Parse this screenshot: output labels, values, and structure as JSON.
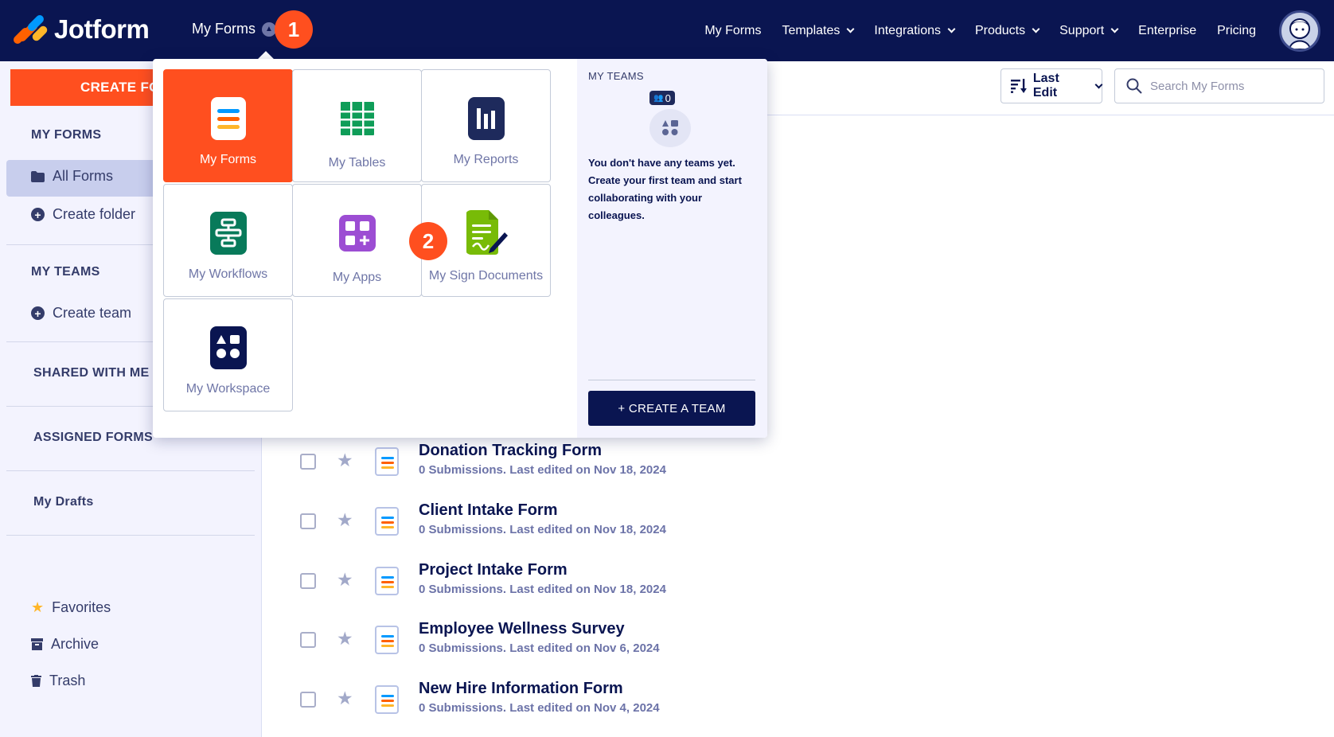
{
  "brand": {
    "name": "Jotform"
  },
  "topnav": {
    "my_forms": "My Forms",
    "links": [
      "My Forms",
      "Templates",
      "Integrations",
      "Products",
      "Support",
      "Enterprise",
      "Pricing"
    ]
  },
  "steps": {
    "one": "1",
    "two": "2"
  },
  "sidebar": {
    "create_label": "CREATE FORM",
    "my_forms_heading": "MY FORMS",
    "all_forms": "All Forms",
    "create_folder": "Create folder",
    "my_teams_heading": "MY TEAMS",
    "create_team": "Create team",
    "shared": "SHARED WITH ME",
    "assigned": "ASSIGNED FORMS",
    "drafts": "My Drafts",
    "favorites": "Favorites",
    "archive": "Archive",
    "trash": "Trash"
  },
  "toolbar": {
    "sort_label": "Last Edit",
    "search_placeholder": "Search My Forms"
  },
  "dropdown": {
    "tiles": [
      "My Forms",
      "My Tables",
      "My Reports",
      "My Workflows",
      "My Apps",
      "My Sign Documents",
      "My Workspace"
    ],
    "teams_title": "MY TEAMS",
    "teams_count": "0",
    "teams_text": "You don't have any teams yet. Create your first team and start collaborating with your colleagues.",
    "create_team_button": "+ CREATE A TEAM"
  },
  "forms": [
    {
      "title": "Donation Tracking Form",
      "sub": "0 Submissions. Last edited on Nov 18, 2024"
    },
    {
      "title": "Client Intake Form",
      "sub": "0 Submissions. Last edited on Nov 18, 2024"
    },
    {
      "title": "Project Intake Form",
      "sub": "0 Submissions. Last edited on Nov 18, 2024"
    },
    {
      "title": "Employee Wellness Survey",
      "sub": "0 Submissions. Last edited on Nov 6, 2024"
    },
    {
      "title": "New Hire Information Form",
      "sub": "0 Submissions. Last edited on Nov 4, 2024"
    }
  ],
  "colors": {
    "navy": "#0a1551",
    "orange": "#ff4f1f",
    "sheet_green": "#0f9d58",
    "workflow_green": "#087a5a",
    "apps_purple": "#9c4dd3",
    "sign_green": "#78bb07"
  }
}
